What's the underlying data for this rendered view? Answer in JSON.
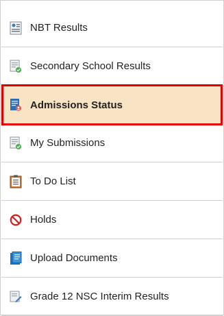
{
  "menu": {
    "items": [
      {
        "label": "NBT Results",
        "icon": "nbt-results-icon"
      },
      {
        "label": "Secondary School Results",
        "icon": "document-check-icon"
      },
      {
        "label": "Admissions Status",
        "icon": "admissions-status-icon",
        "active": true
      },
      {
        "label": "My Submissions",
        "icon": "document-check-icon"
      },
      {
        "label": "To Do List",
        "icon": "clipboard-icon"
      },
      {
        "label": "Holds",
        "icon": "no-entry-icon"
      },
      {
        "label": "Upload Documents",
        "icon": "upload-documents-icon"
      },
      {
        "label": "Grade 12 NSC Interim Results",
        "icon": "document-edit-icon"
      }
    ]
  },
  "colors": {
    "active_bg": "#f8e3c4",
    "active_border": "#e00000",
    "divider": "#cfcfcf",
    "text": "#222222"
  }
}
